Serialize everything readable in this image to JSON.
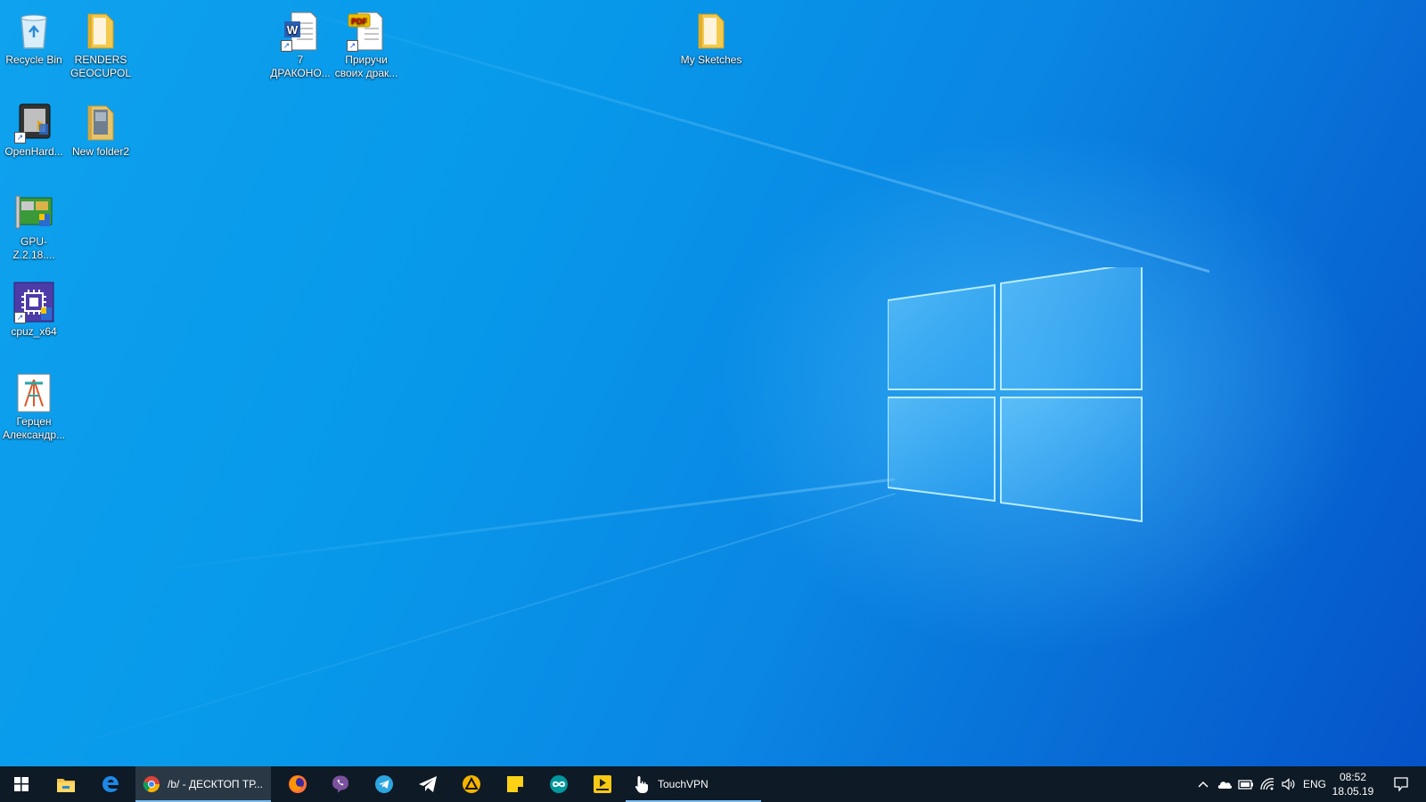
{
  "desktop": {
    "icons": [
      {
        "label": "Recycle Bin",
        "icon": "recycle-bin-icon"
      },
      {
        "label": "RENDERS\nGEOCUPOL",
        "icon": "folder-icon"
      },
      {
        "label": "7\nДРАКОНО...",
        "icon": "word-document-icon"
      },
      {
        "label": "Приручи\nсвоих драк...",
        "icon": "pdf-document-icon"
      },
      {
        "label": "My Sketches",
        "icon": "folder-icon"
      },
      {
        "label": "OpenHard...",
        "icon": "openhardwaremonitor-icon"
      },
      {
        "label": "New folder2",
        "icon": "folder-icon"
      },
      {
        "label": "GPU-Z.2.18....",
        "icon": "gpu-z-icon"
      },
      {
        "label": "cpuz_x64",
        "icon": "cpu-z-icon"
      },
      {
        "label": "Герцен\nАлександр...",
        "icon": "book-icon"
      }
    ]
  },
  "taskbar": {
    "apps": [
      {
        "name": "start",
        "icon": "windows-start-icon"
      },
      {
        "name": "file-explorer",
        "icon": "file-explorer-icon"
      },
      {
        "name": "edge",
        "icon": "edge-icon"
      },
      {
        "name": "chrome",
        "icon": "chrome-icon",
        "label": "/b/ - ДЕСКТОП ТР..."
      },
      {
        "name": "firefox",
        "icon": "firefox-icon"
      },
      {
        "name": "viber",
        "icon": "viber-icon"
      },
      {
        "name": "telegram",
        "icon": "telegram-icon"
      },
      {
        "name": "telegram-alt",
        "icon": "paper-plane-icon"
      },
      {
        "name": "warning-app",
        "icon": "warning-triangle-icon"
      },
      {
        "name": "sticky-notes",
        "icon": "sticky-notes-icon"
      },
      {
        "name": "arduino",
        "icon": "arduino-icon"
      },
      {
        "name": "player",
        "icon": "player-icon"
      },
      {
        "name": "touchvpn",
        "icon": "hand-pointer-icon",
        "label": "TouchVPN"
      }
    ],
    "tray": {
      "language": "ENG",
      "time": "08:52",
      "date": "18.05.19"
    }
  },
  "colors": {
    "taskbar": "#0e1a26",
    "accent": "#76b9ed"
  }
}
